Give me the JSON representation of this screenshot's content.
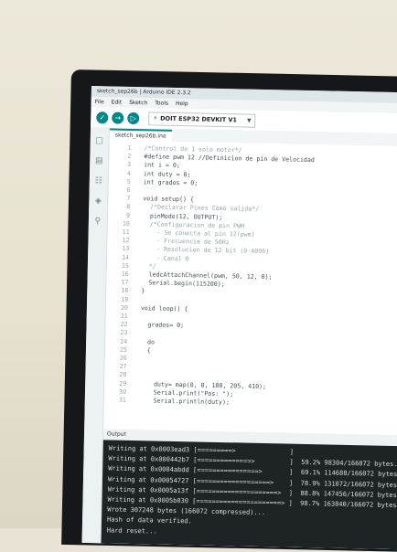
{
  "window": {
    "title": "sketch_sep26b | Arduino IDE 2.3.2"
  },
  "menu": [
    "File",
    "Edit",
    "Sketch",
    "Tools",
    "Help"
  ],
  "toolbar": {
    "board": "DOIT ESP32 DEVKIT V1"
  },
  "tab": {
    "name": "sketch_sep26b.ino"
  },
  "code": {
    "lines": [
      "  /*Control de 1 solo motor*/",
      "  #define pwm 12 //Definicion de pin de Velocidad",
      "  int i = 0;",
      "  int duty = 0;",
      "  int grados = 0;",
      "",
      "  void setup() {",
      "    /*Declarar Pines Como salida*/",
      "    pinMode(12, OUTPUT);",
      "    /*Configuracion de pin PWM",
      "      - Se conecta al pin 12(pwm)",
      "      - Frecuencia de 50Hz",
      "      - Resolucion de 12 bit (0-4096)",
      "      - Canal 0",
      "    */",
      "    ledcAttachChannel(pwm, 50, 12, 0);",
      "    Serial.begin(115200);",
      "  }",
      "",
      "  void loop() {",
      "",
      "    grados= 0;",
      "",
      "    do",
      "    {",
      "",
      "",
      "",
      "      duty= map(0, 0, 180, 205, 410);",
      "      Serial.print(\"Pos: \");",
      "      Serial.println(duty);"
    ]
  },
  "output": {
    "label": "Output",
    "lines": [
      "Writing at 0x0003ead3 [=========>              ]",
      "Writing at 0x000442b7 [==============>         ]  59.2% 98304/166072 bytes...",
      "Writing at 0x0004abdd [================>       ]  69.1% 114688/166072 bytes...",
      "Writing at 0x00054727 [===================>    ]  78.9% 131072/166072 bytes...",
      "Writing at 0x0005a13f [=====================>  ]  88.8% 147456/166072 bytes...",
      "Writing at 0x0005b030 [======================> ]  98.7% 163840/166072 bytes...",
      "Wrote 307248 bytes (166072 compressed)...",
      "Hash of data verified.",
      "Hard reset..."
    ]
  }
}
